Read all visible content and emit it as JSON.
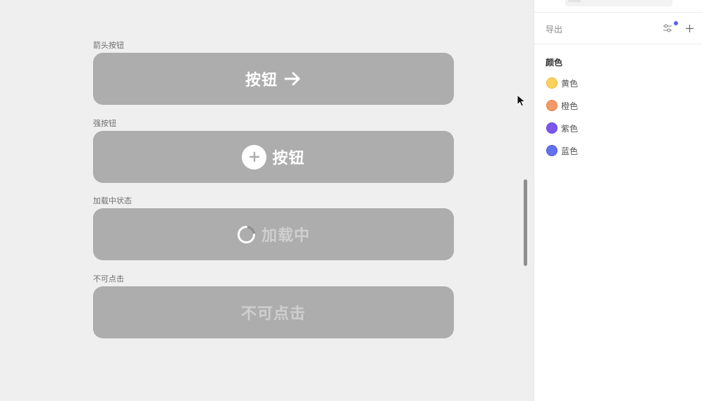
{
  "canvas": {
    "groups": [
      {
        "label": "箭头按钮",
        "button_text": "按钮"
      },
      {
        "label": "强按钮",
        "button_text": "按钮"
      },
      {
        "label": "加载中状态",
        "button_text": "加载中"
      },
      {
        "label": "不可点击",
        "button_text": "不可点击"
      }
    ],
    "icons": {
      "arrow": "arrow-right-icon",
      "plus": "plus-circle-icon",
      "spinner": "spinner-icon",
      "cursor": "mouse-cursor-icon"
    },
    "button_color": "#adadad"
  },
  "panel": {
    "export_title": "导出",
    "section_title": "颜色",
    "indicator_color": "#5b64f0",
    "colors": [
      {
        "name": "黄色",
        "hex": "#fdd25b"
      },
      {
        "name": "橙色",
        "hex": "#f39a66"
      },
      {
        "name": "紫色",
        "hex": "#7a58ea"
      },
      {
        "name": "蓝色",
        "hex": "#6272ec"
      }
    ]
  }
}
